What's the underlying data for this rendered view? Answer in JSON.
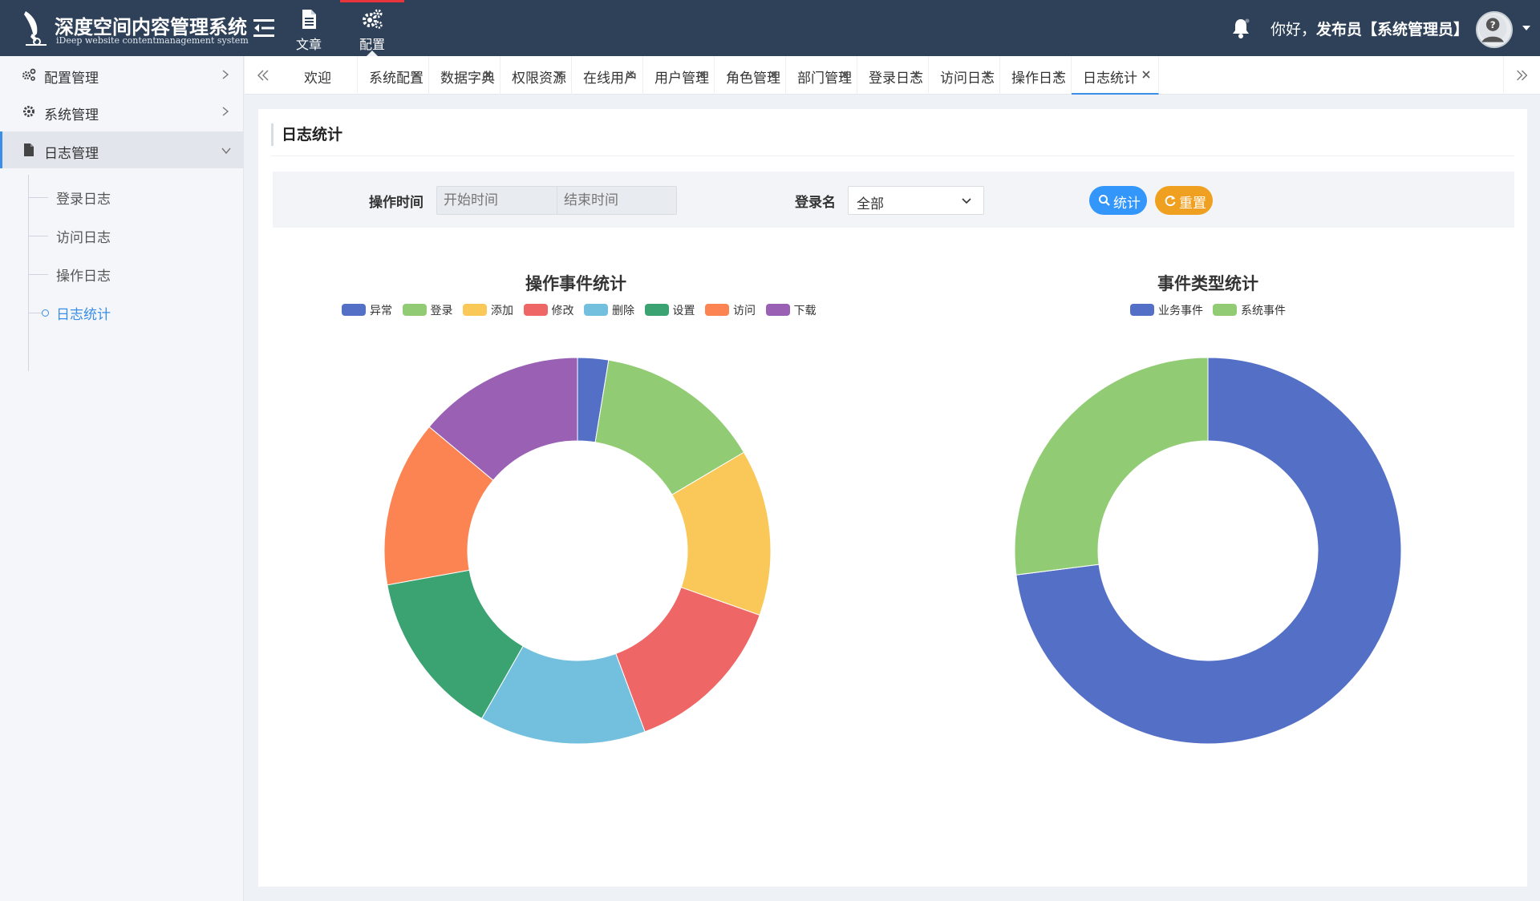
{
  "app": {
    "title": "深度空间内容管理系统",
    "subtitle": "iDeep website contentmanagement system"
  },
  "topnav": {
    "items": [
      {
        "label": "文章",
        "icon": "document-icon",
        "active": false
      },
      {
        "label": "配置",
        "icon": "cogs-icon",
        "active": true
      }
    ]
  },
  "user": {
    "greeting_prefix": "你好，",
    "name": "发布员",
    "role": "【系统管理员】"
  },
  "sidebar": {
    "items": [
      {
        "label": "配置管理",
        "icon": "cogs-icon",
        "expanded": false
      },
      {
        "label": "系统管理",
        "icon": "gear-icon",
        "expanded": false
      },
      {
        "label": "日志管理",
        "icon": "file-icon",
        "expanded": true
      }
    ],
    "subitems": [
      {
        "label": "登录日志",
        "active": false
      },
      {
        "label": "访问日志",
        "active": false
      },
      {
        "label": "操作日志",
        "active": false
      },
      {
        "label": "日志统计",
        "active": true
      }
    ]
  },
  "tabs": [
    {
      "label": "欢迎",
      "closable": false
    },
    {
      "label": "系统配置",
      "closable": true
    },
    {
      "label": "数据字典",
      "closable": true
    },
    {
      "label": "权限资源",
      "closable": true
    },
    {
      "label": "在线用户",
      "closable": true
    },
    {
      "label": "用户管理",
      "closable": true
    },
    {
      "label": "角色管理",
      "closable": true
    },
    {
      "label": "部门管理",
      "closable": true
    },
    {
      "label": "登录日志",
      "closable": true
    },
    {
      "label": "访问日志",
      "closable": true
    },
    {
      "label": "操作日志",
      "closable": true
    },
    {
      "label": "日志统计",
      "closable": true,
      "active": true
    }
  ],
  "page": {
    "title": "日志统计"
  },
  "filter": {
    "time_label": "操作时间",
    "start_placeholder": "开始时间",
    "end_placeholder": "结束时间",
    "login_label": "登录名",
    "login_value": "全部",
    "stat_button": "统计",
    "reset_button": "重置"
  },
  "colors": {
    "primary": "#3a8ee6",
    "stat_button": "#3296fa",
    "reset_button": "#f0a020",
    "topbar": "#2f4159"
  },
  "chart_data": [
    {
      "type": "pie",
      "variant": "donut",
      "title": "操作事件统计",
      "legend_position": "top-center",
      "categories": [
        "异常",
        "登录",
        "添加",
        "修改",
        "删除",
        "设置",
        "访问",
        "下载"
      ],
      "values": [
        2.5,
        13.5,
        13.5,
        13.5,
        13.5,
        13.5,
        13.5,
        13.5
      ],
      "colors": [
        "#5470c6",
        "#91cc75",
        "#fac858",
        "#ee6666",
        "#73c0de",
        "#3ba272",
        "#fc8452",
        "#9a60b4"
      ]
    },
    {
      "type": "pie",
      "variant": "donut",
      "title": "事件类型统计",
      "legend_position": "top-center",
      "categories": [
        "业务事件",
        "系统事件"
      ],
      "values": [
        73,
        27
      ],
      "colors": [
        "#5470c6",
        "#91cc75"
      ]
    }
  ]
}
